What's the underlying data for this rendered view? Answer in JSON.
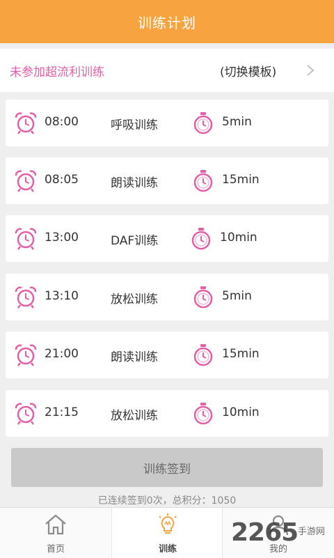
{
  "header": {
    "title": "训练计划"
  },
  "plan": {
    "status": "未参加超流利训练",
    "switch_label": "(切换模板)"
  },
  "schedule": [
    {
      "time": "08:00",
      "name": "呼吸训练",
      "duration": "5min"
    },
    {
      "time": "08:05",
      "name": "朗读训练",
      "duration": "15min"
    },
    {
      "time": "13:00",
      "name": "DAF训练",
      "duration": "10min"
    },
    {
      "time": "13:10",
      "name": "放松训练",
      "duration": "5min"
    },
    {
      "time": "21:00",
      "name": "朗读训练",
      "duration": "15min"
    },
    {
      "time": "21:15",
      "name": "放松训练",
      "duration": "10min"
    }
  ],
  "actions": {
    "signin_label": "训练签到"
  },
  "stats": {
    "streak_text": "已连续签到0次，总积分：1050"
  },
  "tabs": [
    {
      "label": "首页",
      "icon": "home-icon"
    },
    {
      "label": "训练",
      "icon": "lightbulb-icon",
      "active": true
    },
    {
      "label": "我的",
      "icon": "user-icon"
    }
  ],
  "watermark": {
    "brand": "2265",
    "sub": "手游网"
  },
  "colors": {
    "header": "#f7a440",
    "accent_pink": "#e25fa8",
    "button_gray": "#c9c9c9"
  }
}
